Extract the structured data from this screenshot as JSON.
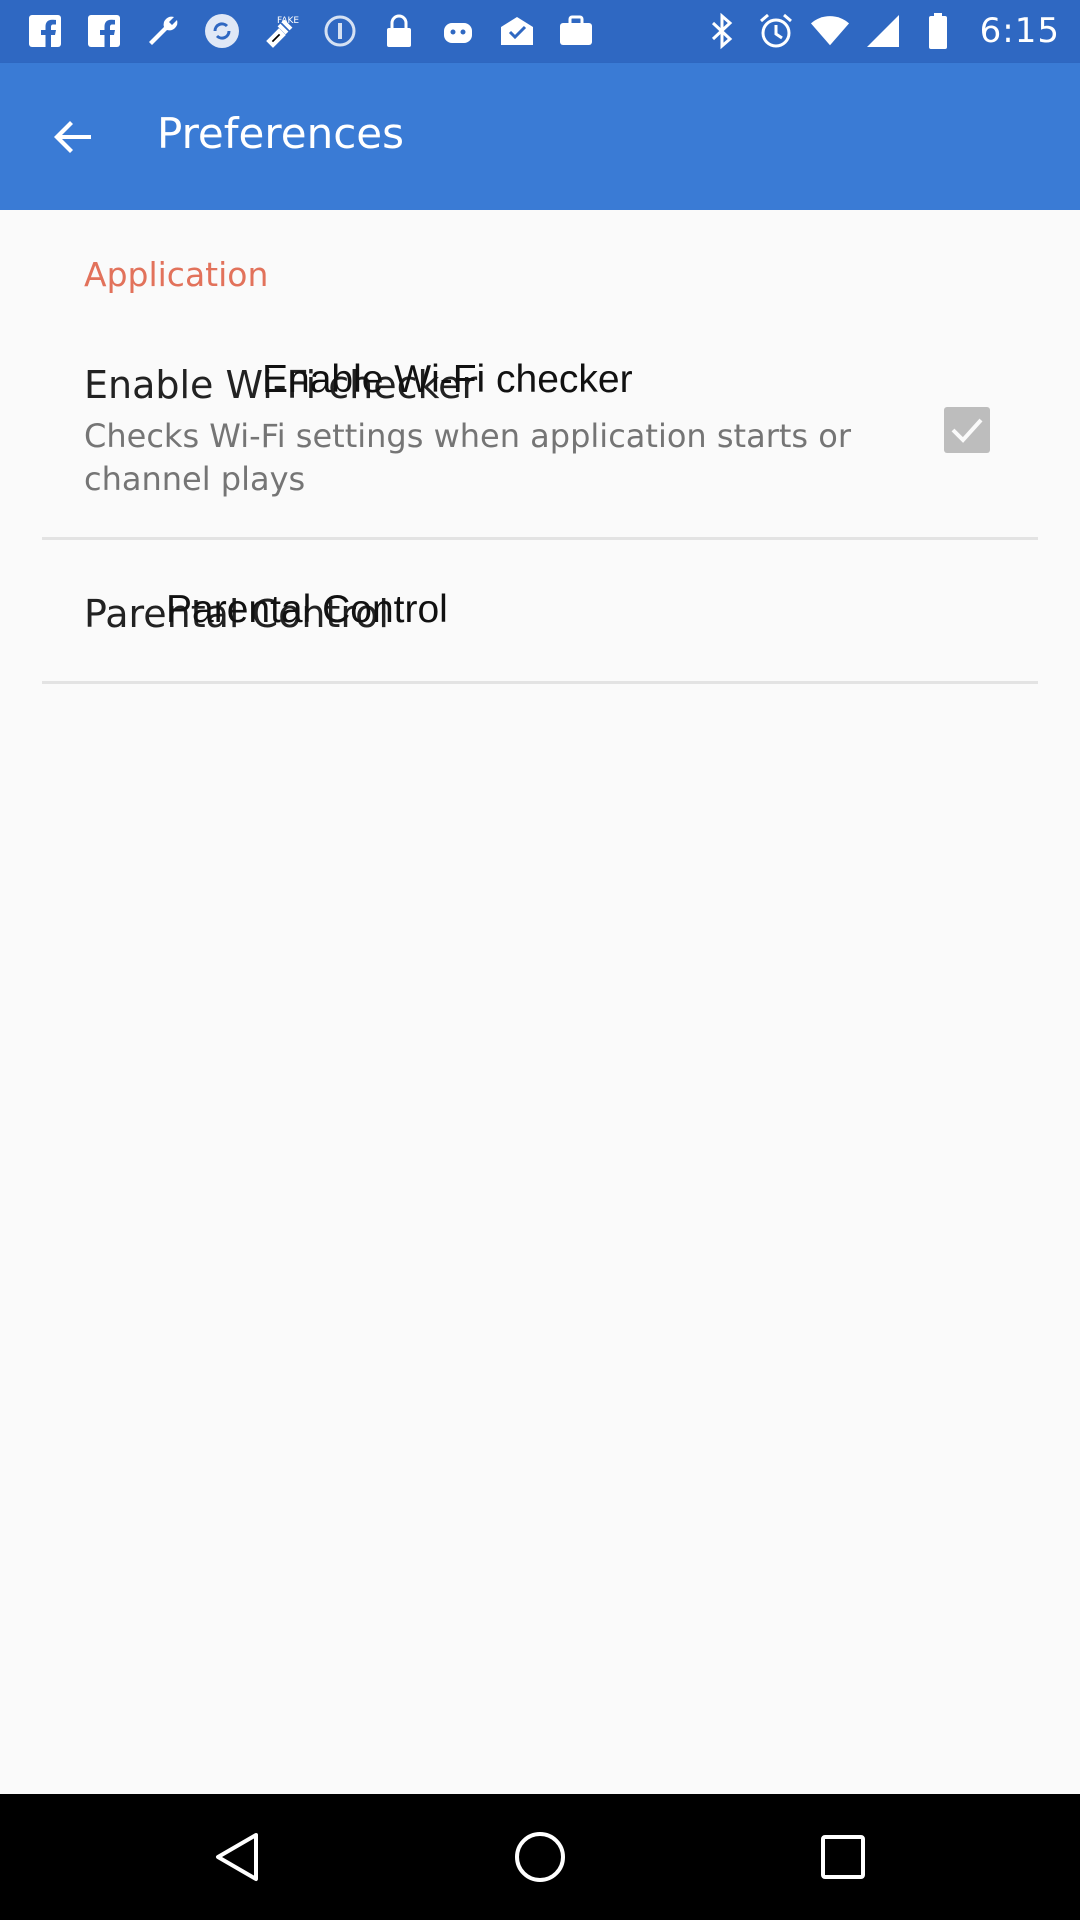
{
  "status_bar": {
    "time": "6:15",
    "left_icons": [
      "facebook-icon",
      "facebook-icon",
      "wrench-icon",
      "sync-icon",
      "fake-gps-icon",
      "info-icon",
      "lock-icon",
      "android-icon",
      "mail-check-icon",
      "briefcase-icon"
    ],
    "right_icons": [
      "bluetooth-icon",
      "alarm-icon",
      "wifi-icon",
      "signal-icon",
      "battery-icon"
    ]
  },
  "app_bar": {
    "back_icon": "arrow-back-icon",
    "title": "Preferences"
  },
  "preferences": {
    "section_header": "Application",
    "items": [
      {
        "title": "Enable Wi-Fi checker",
        "title_overlay": "Enable Wi-Fi checker",
        "summary": "Checks Wi-Fi settings when application starts or channel plays",
        "checked": true
      },
      {
        "title": "Parental Control",
        "title_overlay": "Parental Control"
      }
    ]
  },
  "nav_bar": {
    "icons": [
      "back-triangle-icon",
      "home-circle-icon",
      "recents-square-icon"
    ]
  },
  "colors": {
    "status_bar": "#2f68c2",
    "app_bar": "#3a7bd5",
    "section_header": "#e2725b",
    "checkbox": "#bdbdbd"
  }
}
